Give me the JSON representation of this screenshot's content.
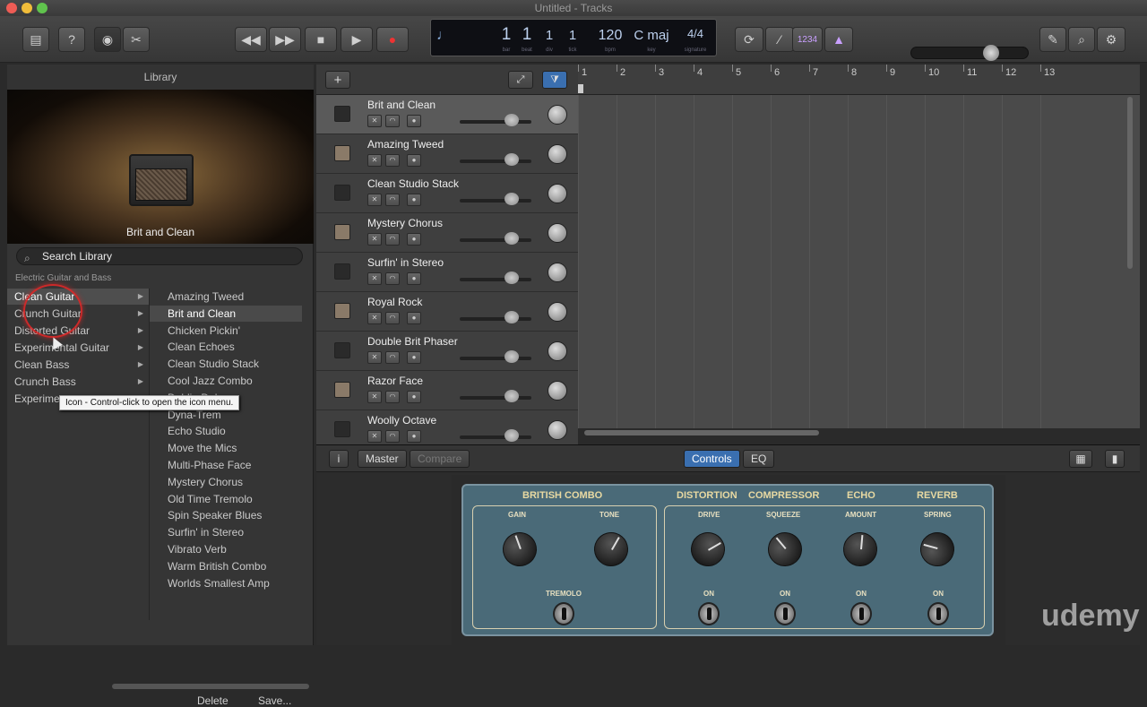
{
  "window": {
    "title": "Untitled - Tracks"
  },
  "lcd": {
    "bar": "1",
    "beat": "1",
    "div": "1",
    "tick": "1",
    "bar_label": "bar",
    "beat_label": "beat",
    "div_label": "div",
    "tick_label": "tick",
    "tempo": "120",
    "tempo_label": "bpm",
    "key": "C maj",
    "key_label": "key",
    "signature": "4/4",
    "signature_label": "signature"
  },
  "toolbar": {
    "count_in": "1234"
  },
  "library": {
    "title": "Library",
    "preview_label": "Brit and Clean",
    "search_placeholder": "Search Library",
    "breadcrumb": "Electric Guitar and Bass",
    "categories": [
      {
        "label": "Clean Guitar"
      },
      {
        "label": "Crunch Guitar"
      },
      {
        "label": "Distorted Guitar"
      },
      {
        "label": "Experimental Guitar"
      },
      {
        "label": "Clean Bass"
      },
      {
        "label": "Crunch Bass"
      },
      {
        "label": "Experime"
      }
    ],
    "presets": [
      "Amazing Tweed",
      "Brit and Clean",
      "Chicken Pickin'",
      "Clean Echoes",
      "Clean Studio Stack",
      "Cool Jazz Combo",
      "Dublin Delay",
      "Dyna-Trem",
      "Echo Studio",
      "Move the Mics",
      "Multi-Phase Face",
      "Mystery Chorus",
      "Old Time Tremolo",
      "Spin Speaker Blues",
      "Surfin' in Stereo",
      "Vibrato Verb",
      "Warm British Combo",
      "Worlds Smallest Amp"
    ],
    "tooltip": "Icon - Control-click to open the icon menu.",
    "delete_label": "Delete",
    "save_label": "Save..."
  },
  "tracks": [
    "Brit and Clean",
    "Amazing Tweed",
    "Clean Studio Stack",
    "Mystery Chorus",
    "Surfin' in Stereo",
    "Royal Rock",
    "Double Brit Phaser",
    "Razor Face",
    "Woolly Octave"
  ],
  "ruler": [
    "1",
    "2",
    "3",
    "4",
    "5",
    "6",
    "7",
    "8",
    "9",
    "10",
    "11",
    "12",
    "13"
  ],
  "smart_controls": {
    "master": "Master",
    "compare": "Compare",
    "controls_tab": "Controls",
    "eq_tab": "EQ",
    "sections": [
      "BRITISH COMBO",
      "DISTORTION",
      "COMPRESSOR",
      "ECHO",
      "REVERB"
    ],
    "knobs": [
      "GAIN",
      "TONE",
      "DRIVE",
      "SQUEEZE",
      "AMOUNT",
      "SPRING"
    ],
    "tremolo": "TREMOLO",
    "on": "ON"
  },
  "watermark": "udemy"
}
